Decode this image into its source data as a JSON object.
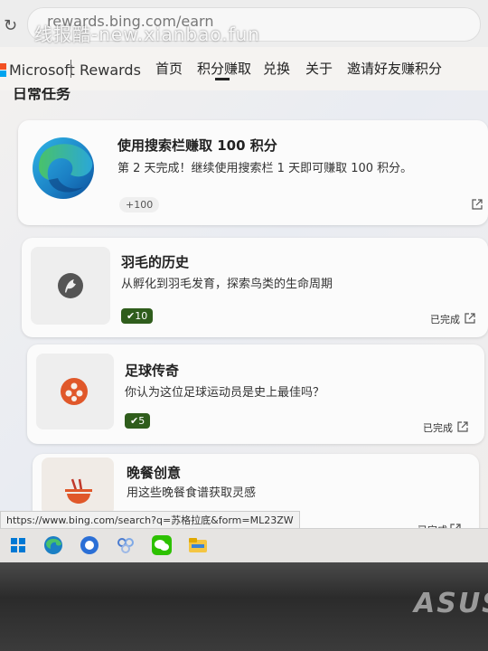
{
  "browser": {
    "url": "rewards.bing.com/earn",
    "watermark": "线报酷-new.xianbao.fun"
  },
  "header": {
    "brand_microsoft": "Microsoft",
    "brand_rewards": "Rewards",
    "nav": [
      "首页",
      "积分赚取",
      "兑换",
      "关于",
      "邀请好友赚积分"
    ],
    "active_nav": "积分赚取"
  },
  "section_title": "日常任务",
  "cards": [
    {
      "title": "使用搜索栏赚取 100 积分",
      "description": "第 2 天完成！继续使用搜索栏 1 天即可赚取 100 积分。",
      "points": "+100",
      "icon": "edge-logo-icon"
    },
    {
      "title": "羽毛的历史",
      "description": "从孵化到羽毛发育，探索鸟类的生命周期",
      "points": "10",
      "status": "已完成",
      "icon": "bird-icon"
    },
    {
      "title": "足球传奇",
      "description": "你认为这位足球运动员是史上最佳吗？",
      "points": "5",
      "status": "已完成",
      "icon": "soccer-ball-icon"
    },
    {
      "title": "晚餐创意",
      "description": "用这些晚餐食谱获取灵感",
      "status": "已完成",
      "icon": "bowl-icon"
    }
  ],
  "status_url": "https://www.bing.com/search?q=苏格拉底&form=ML23ZW",
  "taskbar": [
    "windows-start-icon",
    "edge-icon",
    "chat-icon",
    "app-icon",
    "wechat-icon",
    "file-explorer-icon"
  ],
  "laptop_logo": "ASUS",
  "colors": {
    "done_badge": "#2f5d1c",
    "accent_orange": "#e0582a"
  }
}
